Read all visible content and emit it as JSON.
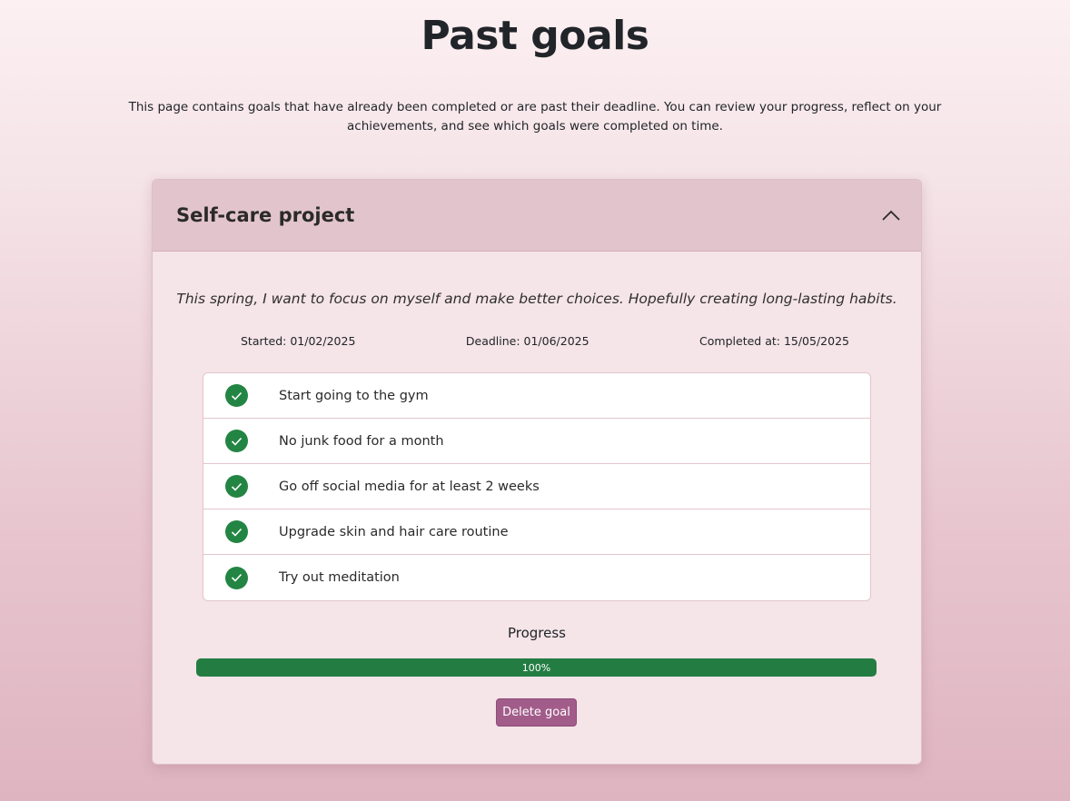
{
  "page": {
    "title": "Past goals",
    "intro": "This page contains goals that have already been completed or are past their deadline. You can review your progress, reflect on your achievements, and see which goals were completed on time."
  },
  "goal": {
    "title": "Self-care project",
    "expanded": true,
    "description": "This spring, I want to focus on myself and make better choices. Hopefully creating long-lasting habits.",
    "started": "Started: 01/02/2025",
    "deadline": "Deadline: 01/06/2025",
    "completed": "Completed at: 15/05/2025",
    "tasks": [
      {
        "label": "Start going to the gym",
        "done": true
      },
      {
        "label": "No junk food for a month",
        "done": true
      },
      {
        "label": "Go off social media for at least 2 weeks",
        "done": true
      },
      {
        "label": "Upgrade skin and hair care routine",
        "done": true
      },
      {
        "label": "Try out meditation",
        "done": true
      }
    ],
    "progress_label": "Progress",
    "progress_value": 100,
    "progress_text": "100%",
    "delete_label": "Delete goal"
  },
  "icons": {
    "toggle": "chevron-up-icon",
    "task_done": "check-circle-icon"
  },
  "colors": {
    "success": "#237d43",
    "accent": "#a25c8a",
    "header": "#e2c4cc"
  }
}
